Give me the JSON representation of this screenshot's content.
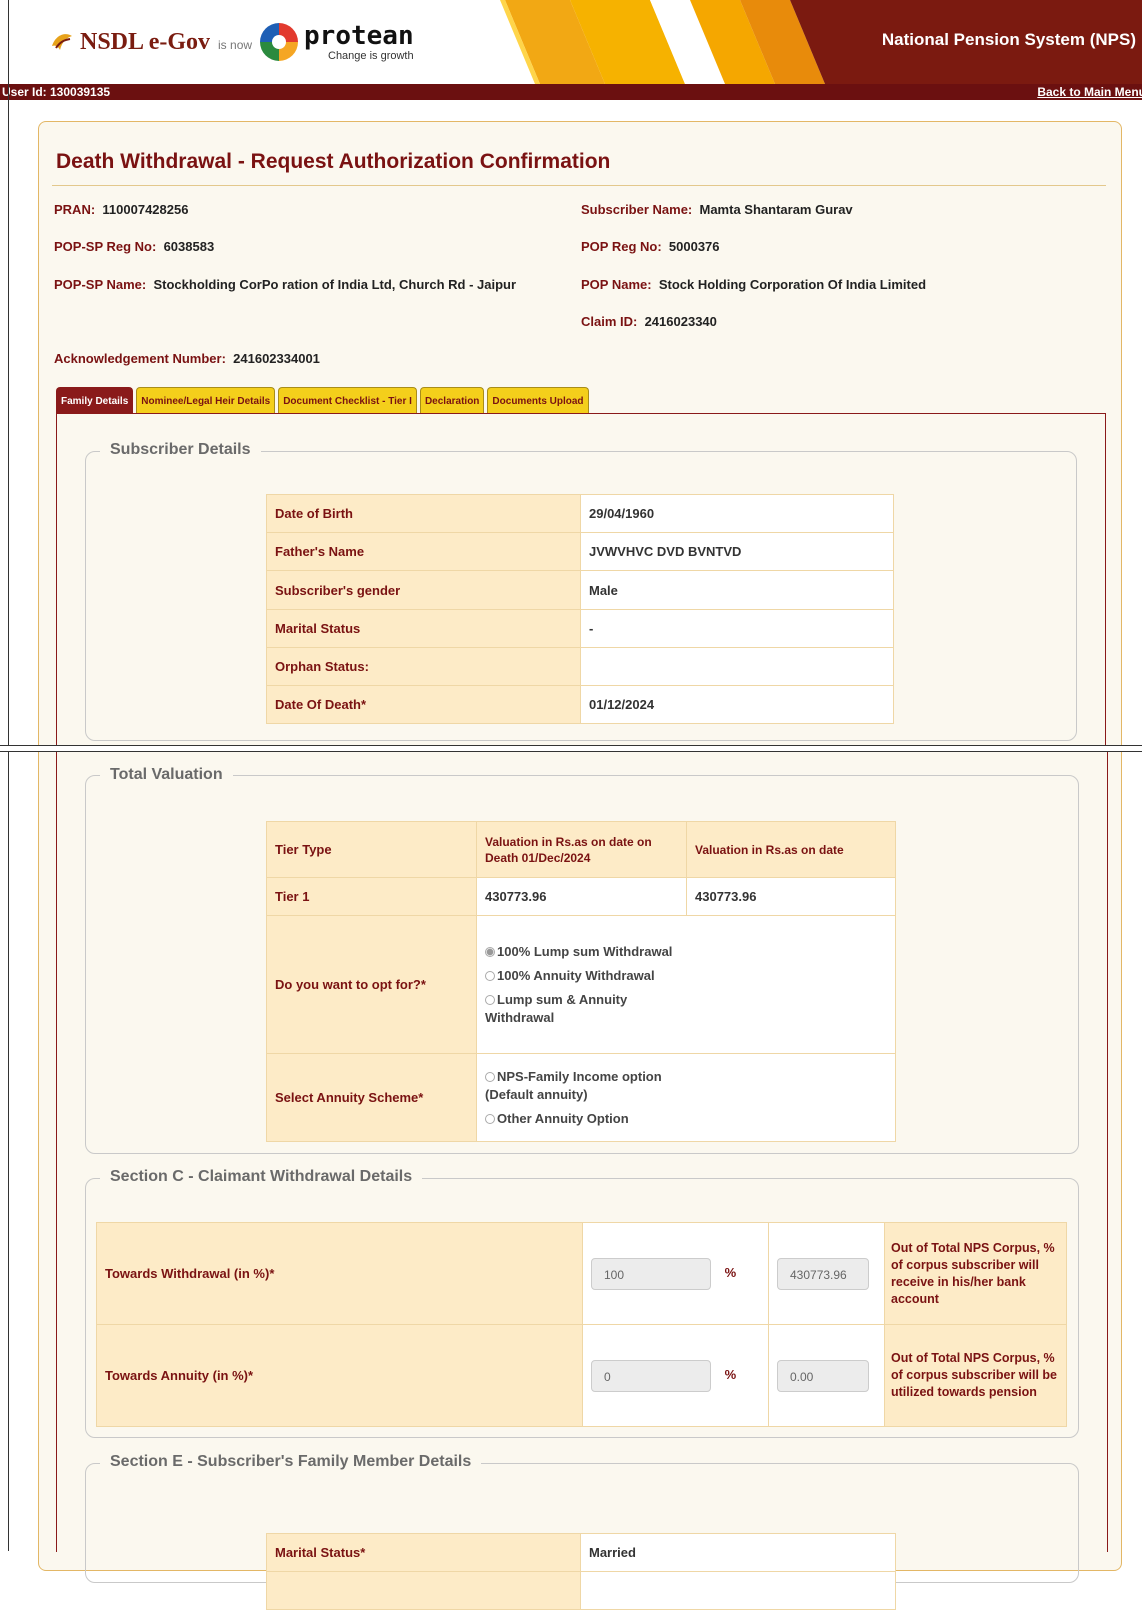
{
  "header": {
    "brand_nsdl": "NSDL e-Gov",
    "brand_isnow": "is now",
    "brand_protean": "protean",
    "brand_tagline": "Change is growth",
    "system_title": "National Pension System (NPS)",
    "logo_icons": [
      "nsdl-leaf-icon",
      "protean-circle-icon"
    ]
  },
  "userbar": {
    "user_id": "User Id: 130039135",
    "back_link": "Back to Main Menu"
  },
  "page": {
    "title": "Death Withdrawal - Request Authorization Confirmation"
  },
  "info": {
    "pran_label": "PRAN:",
    "pran_value": "110007428256",
    "subscriber_name_label": "Subscriber Name:",
    "subscriber_name_value": "Mamta Shantaram Gurav",
    "popsp_reg_label": "POP-SP Reg No:",
    "popsp_reg_value": "6038583",
    "pop_reg_label": "POP Reg No:",
    "pop_reg_value": "5000376",
    "popsp_name_label": "POP-SP Name:",
    "popsp_name_value": "Stockholding CorPo ration of India Ltd, Church Rd - Jaipur",
    "pop_name_label": "POP Name:",
    "pop_name_value": "Stock Holding Corporation Of India Limited",
    "claim_id_label": "Claim ID:",
    "claim_id_value": "2416023340",
    "ack_label": "Acknowledgement Number:",
    "ack_value": "241602334001"
  },
  "tabs": [
    {
      "label": "Family Details",
      "active": true
    },
    {
      "label": "Nominee/Legal Heir Details",
      "active": false
    },
    {
      "label": "Document Checklist - Tier I",
      "active": false
    },
    {
      "label": "Declaration",
      "active": false
    },
    {
      "label": "Documents Upload",
      "active": false
    }
  ],
  "subscriber_details": {
    "legend": "Subscriber Details",
    "rows": [
      {
        "label": "Date of Birth",
        "value": "29/04/1960"
      },
      {
        "label": "Father's Name",
        "value": "JVWVHVC DVD BVNTVD"
      },
      {
        "label": "Subscriber's gender",
        "value": "Male"
      },
      {
        "label": "Marital Status",
        "value": "-"
      },
      {
        "label": "Orphan Status:",
        "value": ""
      },
      {
        "label": "Date Of Death*",
        "value": "01/12/2024"
      }
    ]
  },
  "total_valuation": {
    "legend": "Total Valuation",
    "head_tier": "Tier Type",
    "head_val_death": "Valuation in Rs.as on date on Death 01/Dec/2024",
    "head_val_date": "Valuation in Rs.as on date",
    "tier_label": "Tier 1",
    "tier_val_death": "430773.96",
    "tier_val_date": "430773.96",
    "opt_label": "Do you want to opt for?*",
    "opt_1": "100% Lump sum Withdrawal",
    "opt_2": "100% Annuity Withdrawal",
    "opt_3": "Lump sum & Annuity Withdrawal",
    "opt_selected": "100% Lump sum Withdrawal",
    "scheme_label": "Select Annuity Scheme*",
    "scheme_1": "NPS-Family Income option (Default annuity)",
    "scheme_2": "Other Annuity Option"
  },
  "section_c": {
    "legend": "Section C - Claimant Withdrawal Details",
    "withdrawal_label": "Towards Withdrawal (in %)*",
    "withdrawal_pct": "100",
    "withdrawal_amount": "430773.96",
    "withdrawal_note": "Out of Total NPS Corpus, % of corpus subscriber will receive in his/her bank account",
    "annuity_label": "Towards Annuity (in %)*",
    "annuity_pct": "0",
    "annuity_amount": "0.00",
    "annuity_note": "Out of Total NPS Corpus, % of corpus subscriber will be utilized towards pension",
    "percent_sign": "%"
  },
  "section_e": {
    "legend": "Section E - Subscriber's Family Member Details",
    "marital_label": "Marital Status*",
    "marital_value": "Married"
  },
  "colors": {
    "brand_maroon": "#7a1212",
    "tab_yellow": "#f4cf1b",
    "table_header_bg": "#fdebc7",
    "page_bg": "#fbf8ef"
  }
}
